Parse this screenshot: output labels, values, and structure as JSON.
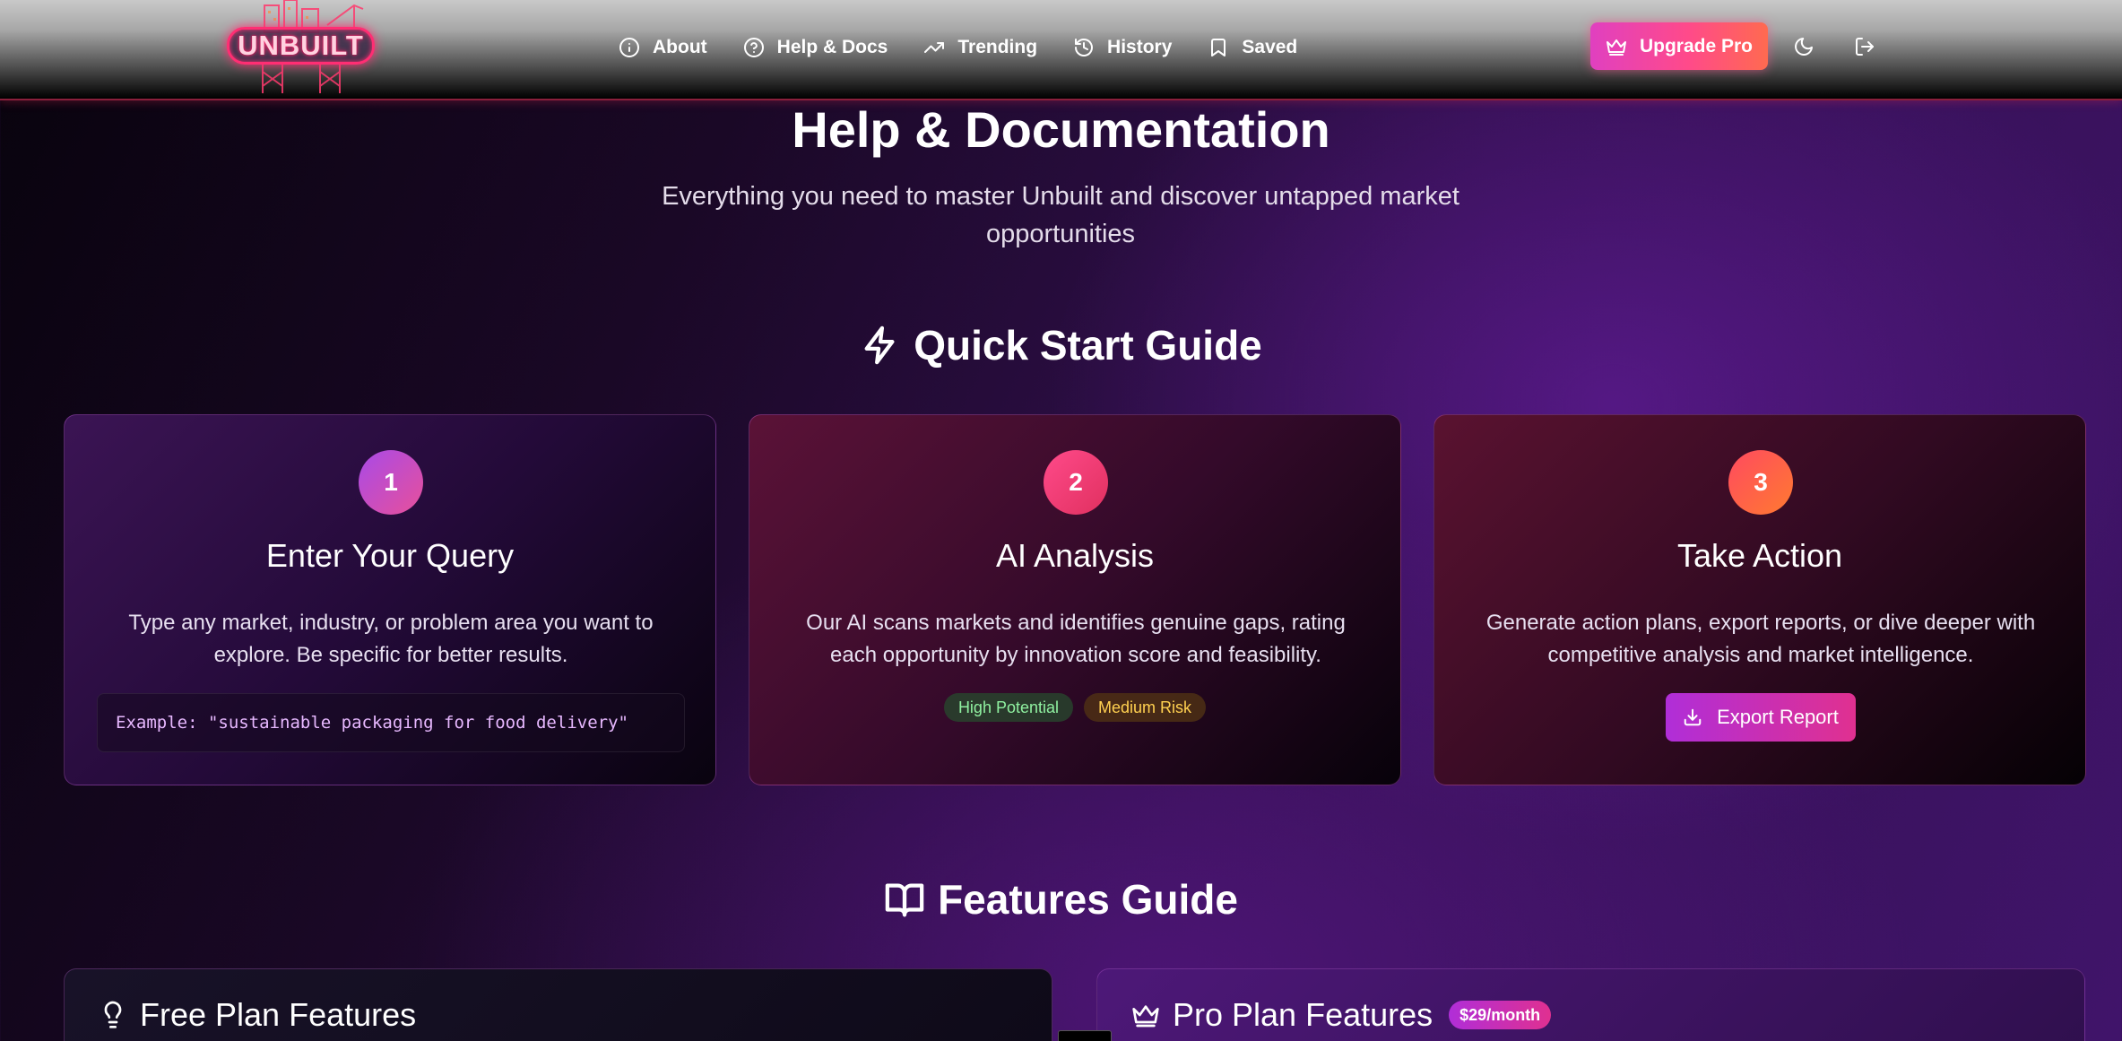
{
  "header": {
    "logo_text": "UNBUILT",
    "nav": [
      {
        "label": "About",
        "icon": "info-icon"
      },
      {
        "label": "Help & Docs",
        "icon": "help-circle-icon"
      },
      {
        "label": "Trending",
        "icon": "trending-up-icon"
      },
      {
        "label": "History",
        "icon": "history-icon"
      },
      {
        "label": "Saved",
        "icon": "bookmark-icon"
      }
    ],
    "upgrade_label": "Upgrade Pro",
    "theme_toggle_icon": "moon-icon",
    "logout_icon": "logout-icon"
  },
  "page": {
    "title": "Help & Documentation",
    "subtitle": "Everything you need to master Unbuilt and discover untapped market opportunities"
  },
  "quick_start": {
    "title": "Quick Start Guide",
    "steps": [
      {
        "number": "1",
        "title": "Enter Your Query",
        "description": "Type any market, industry, or problem area you want to explore. Be specific for better results.",
        "example": "Example: \"sustainable packaging for food delivery\""
      },
      {
        "number": "2",
        "title": "AI Analysis",
        "description": "Our AI scans markets and identifies genuine gaps, rating each opportunity by innovation score and feasibility.",
        "badges": [
          "High Potential",
          "Medium Risk"
        ]
      },
      {
        "number": "3",
        "title": "Take Action",
        "description": "Generate action plans, export reports, or dive deeper with competitive analysis and market intelligence.",
        "button": "Export Report"
      }
    ]
  },
  "features": {
    "title": "Features Guide",
    "free_title": "Free Plan Features",
    "pro_title": "Pro Plan Features",
    "pro_price": "$29/month"
  },
  "colors": {
    "accent_pink": "#ff4a8a",
    "accent_purple": "#b02ed8",
    "badge_green": "#8ff0a0",
    "badge_amber": "#ffd050"
  }
}
